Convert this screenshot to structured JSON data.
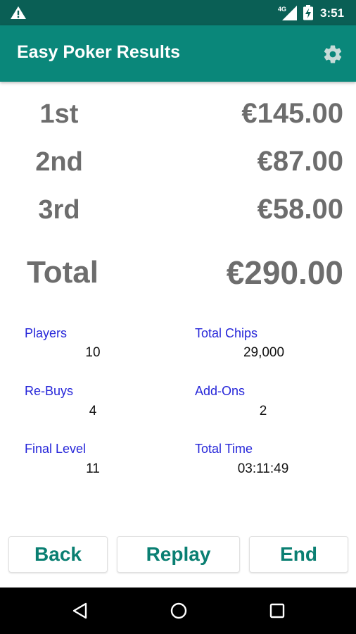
{
  "status_bar": {
    "network": "4G",
    "time": "3:51",
    "icons": [
      "warning-icon",
      "signal-icon",
      "battery-icon"
    ]
  },
  "app_bar": {
    "title": "Easy Poker Results",
    "settings_icon": "gear-icon"
  },
  "prizes": [
    {
      "place": "1st",
      "amount": "€145.00"
    },
    {
      "place": "2nd",
      "amount": "€87.00"
    },
    {
      "place": "3rd",
      "amount": "€58.00"
    }
  ],
  "total": {
    "label": "Total",
    "amount": "€290.00"
  },
  "stats": {
    "players": {
      "label": "Players",
      "value": "10"
    },
    "total_chips": {
      "label": "Total Chips",
      "value": "29,000"
    },
    "rebuys": {
      "label": "Re-Buys",
      "value": "4"
    },
    "addons": {
      "label": "Add-Ons",
      "value": "2"
    },
    "final_level": {
      "label": "Final Level",
      "value": "11"
    },
    "total_time": {
      "label": "Total Time",
      "value": "03:11:49"
    }
  },
  "buttons": {
    "back": "Back",
    "replay": "Replay",
    "end": "End"
  },
  "nav_bar": {
    "icons": [
      "back-triangle-icon",
      "home-circle-icon",
      "recents-square-icon"
    ]
  },
  "colors": {
    "status_bar": "#0a5f55",
    "app_bar": "#0a877a",
    "accent_text": "#0a7f72",
    "stat_label": "#2626d9",
    "prize_text": "#6d6d6d"
  }
}
